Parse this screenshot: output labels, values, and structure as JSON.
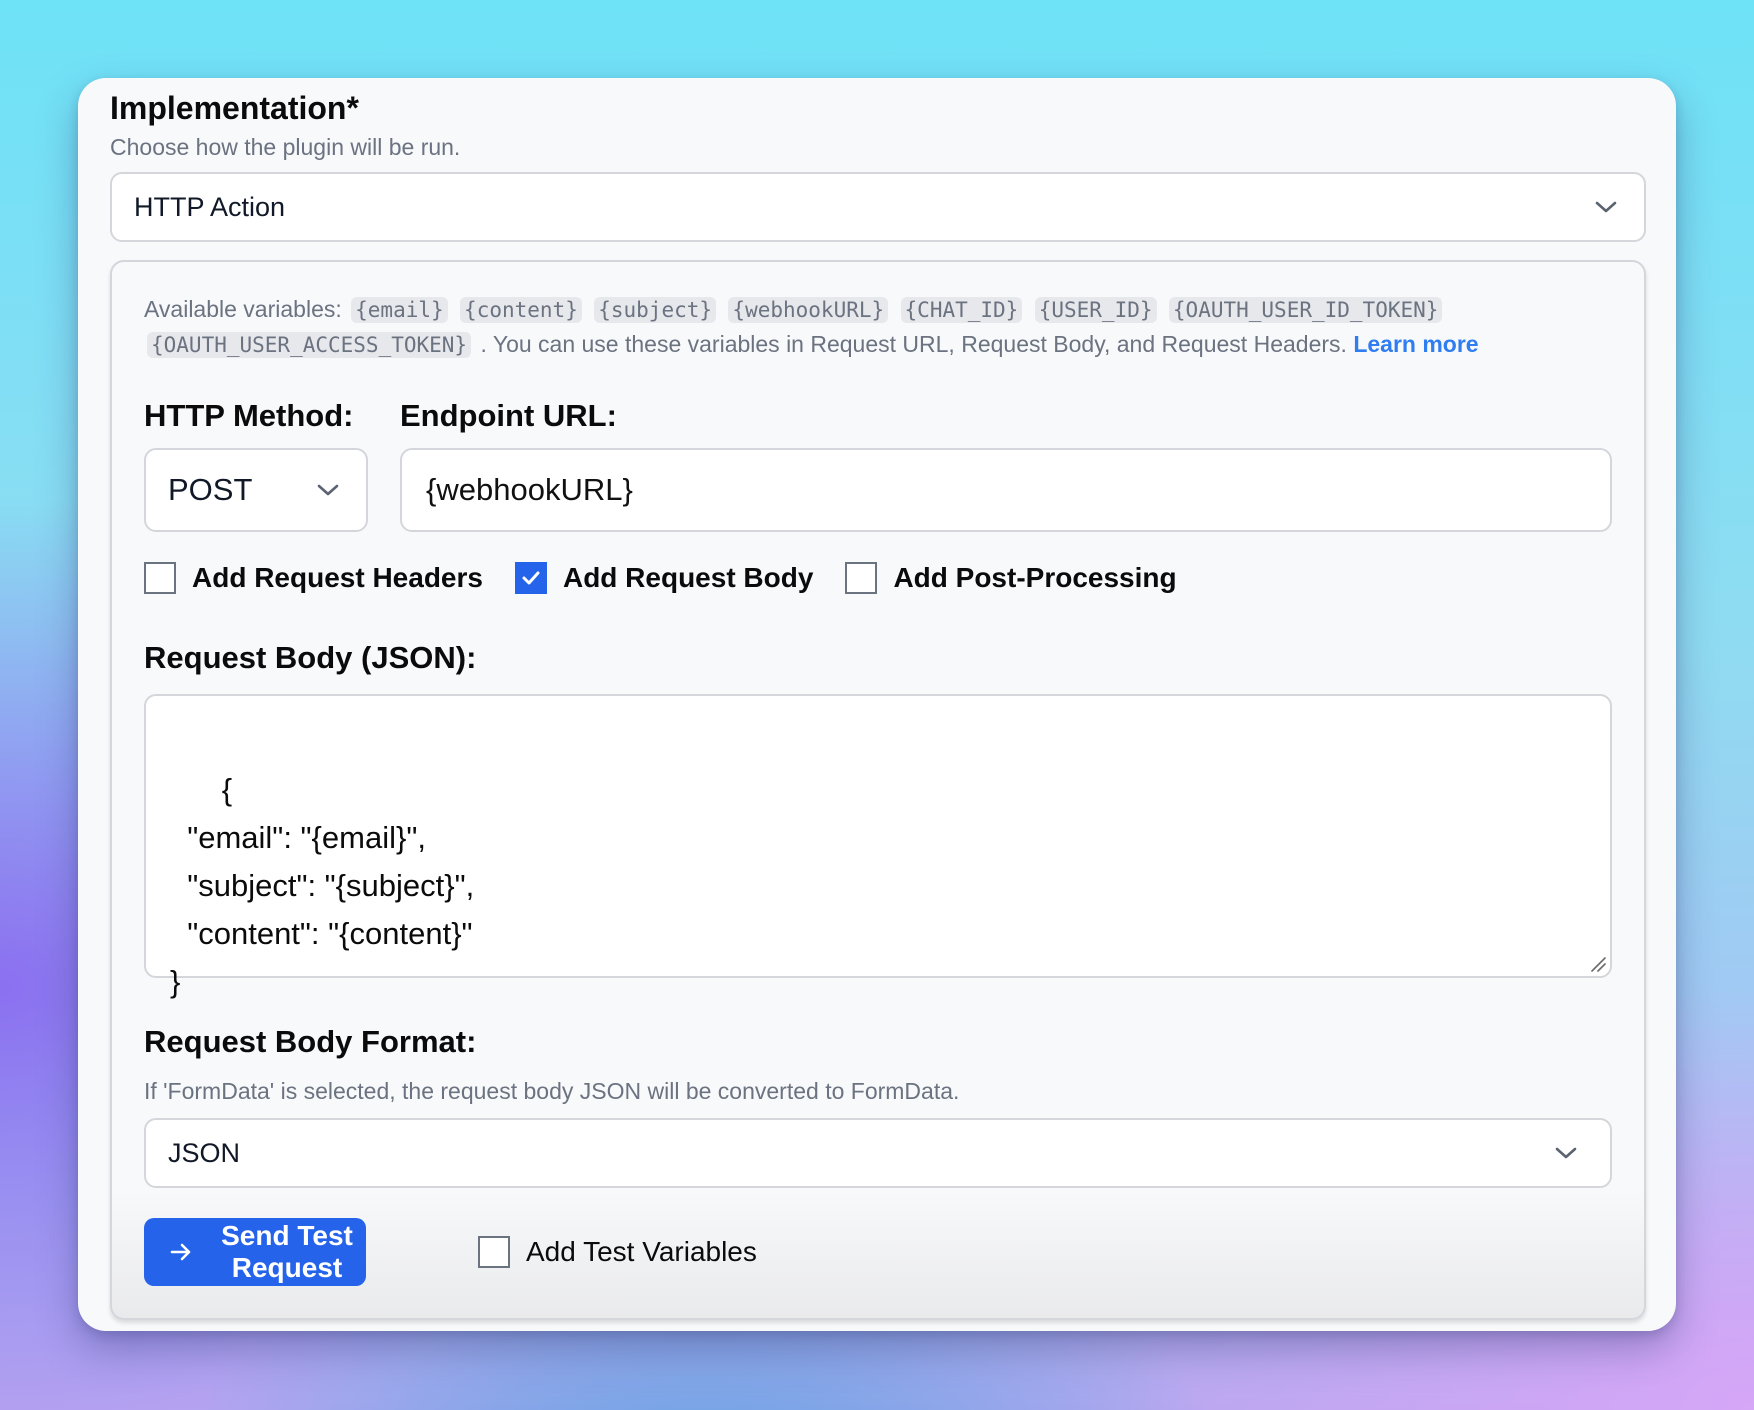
{
  "implementation": {
    "title": "Implementation*",
    "subtitle": "Choose how the plugin will be run.",
    "selected": "HTTP Action",
    "chevron_icon": "chevron-down-icon"
  },
  "variables": {
    "prefix": "Available variables:",
    "chips": [
      "{email}",
      "{content}",
      "{subject}",
      "{webhookURL}",
      "{CHAT_ID}",
      "{USER_ID}",
      "{OAUTH_USER_ID_TOKEN}",
      "{OAUTH_USER_ACCESS_TOKEN}"
    ],
    "suffix": ". You can use these variables in Request URL, Request Body, and Request Headers.",
    "learn_more": "Learn more"
  },
  "http": {
    "method_label": "HTTP Method:",
    "method_value": "POST",
    "url_label": "Endpoint URL:",
    "url_value": "{webhookURL}"
  },
  "options": [
    {
      "label": "Add Request Headers",
      "checked": false
    },
    {
      "label": "Add Request Body",
      "checked": true
    },
    {
      "label": "Add Post-Processing",
      "checked": false
    }
  ],
  "request_body": {
    "label": "Request Body (JSON):",
    "value": "{\n  \"email\": \"{email}\",\n  \"subject\": \"{subject}\",\n  \"content\": \"{content}\"\n}"
  },
  "body_format": {
    "label": "Request Body Format:",
    "hint": "If 'FormData' is selected, the request body JSON will be converted to FormData.",
    "selected": "JSON"
  },
  "actions": {
    "send_label": "Send Test Request",
    "send_icon": "arrow-right-icon",
    "test_vars_label": "Add Test Variables",
    "test_vars_checked": false
  },
  "colors": {
    "accent": "#2563eb",
    "link": "#2f7df0",
    "muted_text": "#6b7280"
  }
}
